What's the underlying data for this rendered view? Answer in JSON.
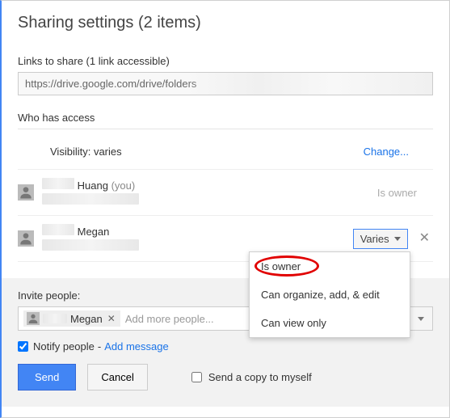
{
  "title": "Sharing settings (2 items)",
  "links": {
    "label": "Links to share (1 link accessible)",
    "url_visible": "https://drive.google.com/drive/folders"
  },
  "access": {
    "heading": "Who has access",
    "visibility_label": "Visibility: varies",
    "change_label": "Change...",
    "entries": [
      {
        "name": "Huang",
        "suffix": "(you)",
        "role_label": "Is owner"
      },
      {
        "name": "Megan",
        "role_label": "Varies"
      }
    ],
    "dropdown": {
      "options": [
        "Is owner",
        "Can organize, add, & edit",
        "Can view only"
      ]
    }
  },
  "invite": {
    "label": "Invite people:",
    "chip_name": "Megan",
    "placeholder": "Add more people...",
    "notify_label": "Notify people",
    "add_message_label": "Add message",
    "send_label": "Send",
    "cancel_label": "Cancel",
    "send_copy_label": "Send a copy to myself"
  }
}
